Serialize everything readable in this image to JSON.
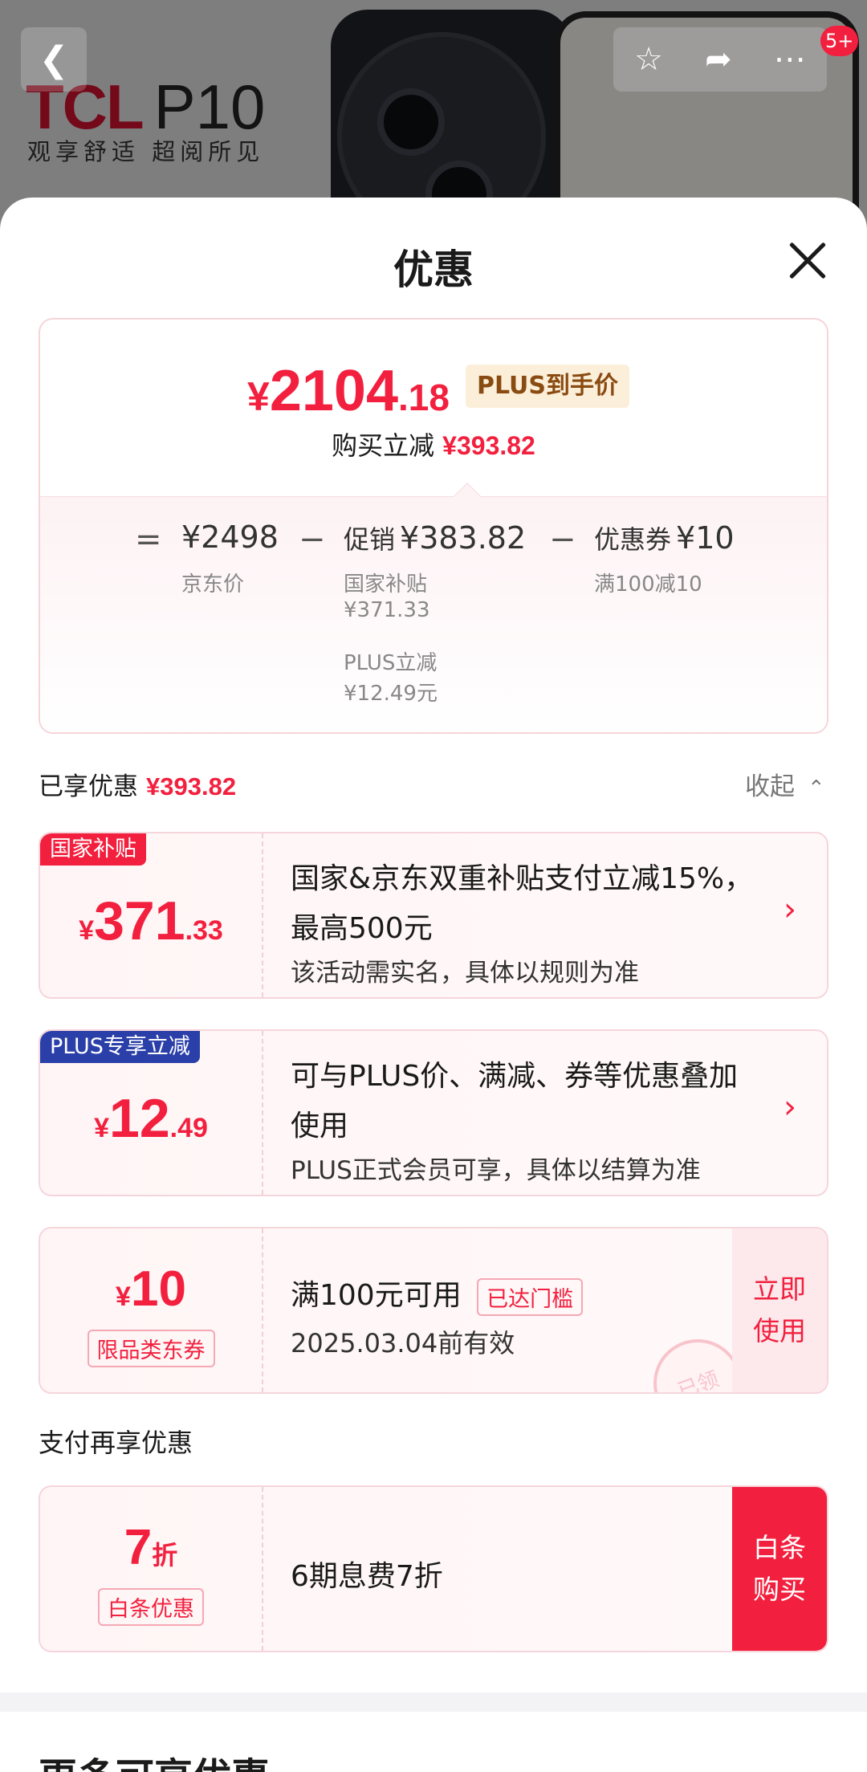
{
  "banner": {
    "brand": "TCL",
    "model": "P10",
    "slogan": "观享舒适 超阅所见",
    "notification_count": "5+"
  },
  "sheet": {
    "title": "优惠"
  },
  "summary": {
    "final_price": {
      "currency": "¥",
      "integer": "2104",
      "decimal": ".18"
    },
    "plus_tag": "PLUS到手价",
    "reduce_label": "购买立减",
    "reduce_amount": "¥393.82",
    "breakdown": {
      "eq": "=",
      "minus": "−",
      "jd_price": "¥2498",
      "jd_price_label": "京东价",
      "promo_label": "促销",
      "promo_amount": "¥383.82",
      "promo_sub1_label": "国家补贴",
      "promo_sub1_amount": "¥371.33",
      "promo_sub2_label": "PLUS立减",
      "promo_sub2_amount": "¥12.49元",
      "coupon_label": "优惠券",
      "coupon_amount": "¥10",
      "coupon_sub": "满100减10"
    }
  },
  "enjoyed": {
    "label": "已享优惠",
    "amount": "¥393.82",
    "collapse_label": "收起"
  },
  "cards": {
    "subsidy": {
      "tag": "国家补贴",
      "currency": "¥",
      "integer": "371",
      "decimal": ".33",
      "desc": "国家&京东双重补贴支付立减15%，最高500元",
      "note": "该活动需实名，具体以规则为准"
    },
    "plus": {
      "tag": "PLUS专享立减",
      "currency": "¥",
      "integer": "12",
      "decimal": ".49",
      "desc": "可与PLUS价、满减、券等优惠叠加使用",
      "note": "PLUS正式会员可享，具体以结算为准"
    },
    "coupon": {
      "currency": "¥",
      "integer": "10",
      "type_label": "限品类东券",
      "condition": "满100元可用",
      "status_badge": "已达门槛",
      "validity": "2025.03.04前有效",
      "action": "立即使用",
      "stamp": "已领"
    }
  },
  "payment": {
    "section_title": "支付再享优惠",
    "discount_num": "7",
    "discount_unit": "折",
    "type_label": "白条优惠",
    "desc": "6期息费7折",
    "action": "白条购买"
  },
  "more": {
    "title": "更多可享优惠"
  },
  "colors": {
    "accent_red": "#f2203e",
    "plus_blue": "#2b3fa8",
    "plus_tag_bg": "#fcefd9"
  }
}
